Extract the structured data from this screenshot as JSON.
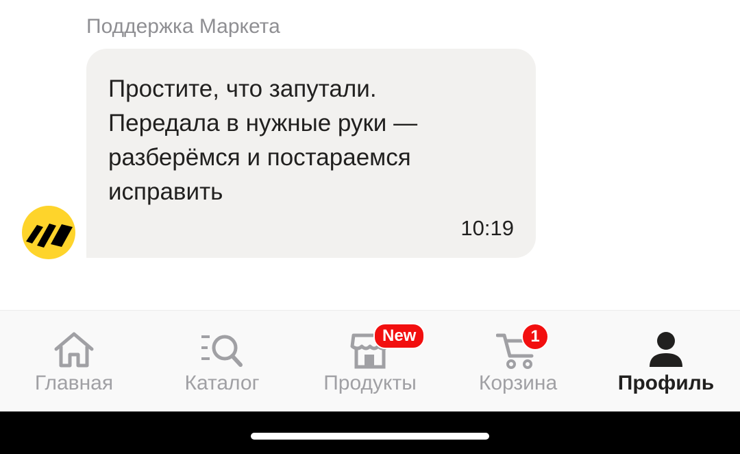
{
  "chat": {
    "sender": "Поддержка Маркета",
    "message": {
      "text": "Простите, что запутали.\nПередала в нужные руки —\nразберёмся и постараемся\nисправить",
      "time": "10:19"
    },
    "avatar_icon": "yandex-market-logo-icon"
  },
  "tabbar": {
    "tabs": [
      {
        "label": "Главная",
        "icon": "home-icon",
        "active": false
      },
      {
        "label": "Каталог",
        "icon": "catalog-search-icon",
        "active": false
      },
      {
        "label": "Продукты",
        "icon": "store-icon",
        "active": false,
        "badge": "New"
      },
      {
        "label": "Корзина",
        "icon": "cart-icon",
        "active": false,
        "badge": "1"
      },
      {
        "label": "Профиль",
        "icon": "profile-icon",
        "active": true
      }
    ]
  },
  "colors": {
    "bubble_bg": "#f2f1ef",
    "avatar_bg": "#fed42b",
    "badge": "#f20f0f",
    "inactive": "#a0a0a4",
    "active": "#21201f"
  }
}
